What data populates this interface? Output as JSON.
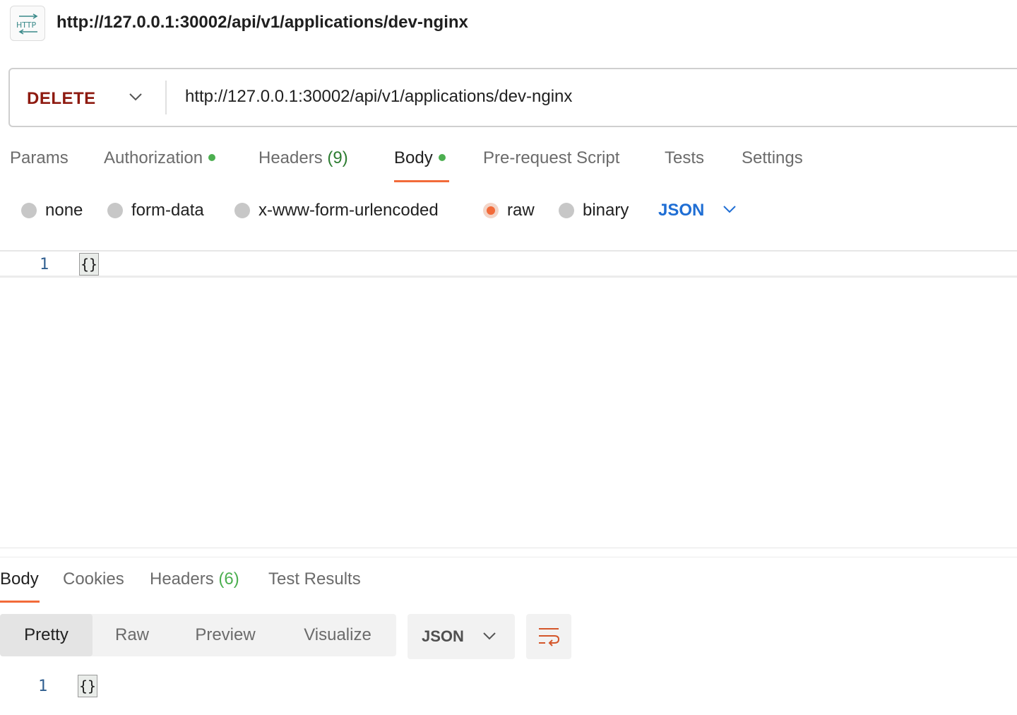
{
  "header": {
    "badge_icon": "http-icon",
    "title": "http://127.0.0.1:30002/api/v1/applications/dev-nginx"
  },
  "request": {
    "method": "DELETE",
    "url": "http://127.0.0.1:30002/api/v1/applications/dev-nginx",
    "tabs": [
      {
        "label": "Params"
      },
      {
        "label": "Authorization",
        "dot": true
      },
      {
        "label": "Headers",
        "count": "(9)"
      },
      {
        "label": "Body",
        "dot": true,
        "active": true
      },
      {
        "label": "Pre-request Script"
      },
      {
        "label": "Tests"
      },
      {
        "label": "Settings"
      }
    ],
    "body_types": [
      "none",
      "form-data",
      "x-www-form-urlencoded",
      "raw",
      "binary"
    ],
    "selected_body_type": "raw",
    "language": "JSON",
    "editor": {
      "line_number": "1",
      "content": "{}"
    }
  },
  "response": {
    "tabs": [
      {
        "label": "Body",
        "active": true
      },
      {
        "label": "Cookies"
      },
      {
        "label": "Headers",
        "count": "(6)"
      },
      {
        "label": "Test Results"
      }
    ],
    "views": [
      "Pretty",
      "Raw",
      "Preview",
      "Visualize"
    ],
    "active_view": "Pretty",
    "format": "JSON",
    "wrap_icon": "wrap-lines-icon",
    "editor": {
      "line_number": "1",
      "content": "{}"
    }
  },
  "colors": {
    "method": "#8e1a10",
    "accent": "#f26b3a",
    "link": "#1f6ed4",
    "dot": "#4caf50"
  }
}
